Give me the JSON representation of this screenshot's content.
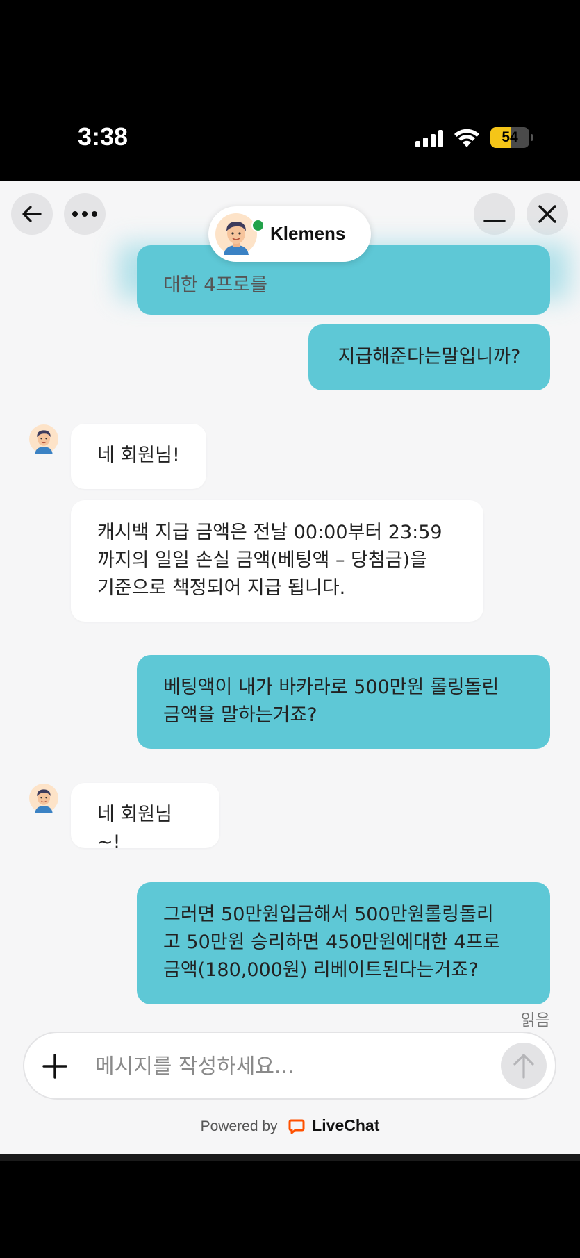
{
  "status_bar": {
    "time": "3:38",
    "battery_percent": "54",
    "battery_level": 0.54,
    "icons": [
      "signal-icon",
      "wifi-icon",
      "battery-icon"
    ]
  },
  "header": {
    "agent_name": "Klemens",
    "agent_status": "online",
    "back_icon": "arrow-left-icon",
    "more_icon": "more-horizontal-icon",
    "minimize_icon": "minimize-icon",
    "close_icon": "close-icon"
  },
  "messages": [
    {
      "from": "visitor",
      "text": "대한 4프로를"
    },
    {
      "from": "visitor",
      "text": "지급해준다는말입니까?"
    },
    {
      "from": "agent",
      "text": "네 회원님!"
    },
    {
      "from": "agent",
      "text": "캐시백 지급 금액은 전날 00:00부터 23:59\n까지의 일일 손실 금액(베팅액 – 당첨금)을\n기준으로 책정되어 지급 됩니다."
    },
    {
      "from": "visitor",
      "text": "베팅액이 내가 바카라로 500만원 롤링돌린\n금액을 말하는거죠?"
    },
    {
      "from": "agent",
      "text": "네 회원님~!"
    },
    {
      "from": "visitor",
      "text": "그러면 50만원입금해서 500만원롤링돌리\n고 50만원 승리하면 450만원에대한 4프로\n금액(180,000원) 리베이트된다는거죠?"
    }
  ],
  "read_receipt": "읽음",
  "composer": {
    "placeholder": "메시지를 작성하세요...",
    "add_icon": "plus-icon",
    "send_icon": "arrow-up-icon"
  },
  "footer": {
    "powered_by": "Powered by",
    "brand": "LiveChat"
  },
  "colors": {
    "visitor_bubble": "#5ec8d6",
    "agent_bubble": "#ffffff",
    "chat_background": "#f6f6f7",
    "livechat_orange": "#ff5100",
    "online": "#22a24a"
  }
}
